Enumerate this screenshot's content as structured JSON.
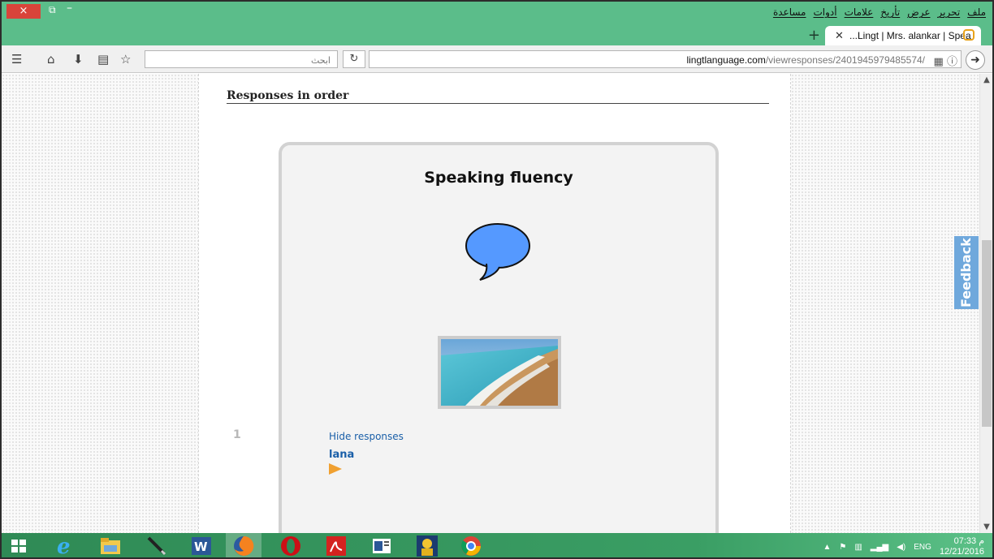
{
  "window": {
    "close_glyph": "×",
    "restore_glyph": "⧉",
    "minimize_glyph": "–"
  },
  "menu": {
    "items": [
      "ملف",
      "تحرير",
      "عرض",
      "تأريخ",
      "علامات",
      "أدوات",
      "مساعدة"
    ]
  },
  "tab": {
    "title": "...Lingt | Mrs. alankar | Spea",
    "close_glyph": "✕",
    "new_tab_glyph": "+"
  },
  "navbar": {
    "search_placeholder": "ابحث",
    "url_domain": "lingtlanguage.com",
    "url_path": "/viewresponses/2401945979485574/"
  },
  "page": {
    "heading": "Responses in order",
    "card_title": "Speaking fluency",
    "hide_responses": "Hide responses",
    "responder": "lana",
    "row_number": "1",
    "feedback_tab": "Feedback"
  },
  "taskbar": {
    "lang": "ENG",
    "time": "07:33 م",
    "date": "12/21/2016"
  },
  "colors": {
    "chrome_green": "#5bbd8a",
    "bubble_blue": "#5599ff",
    "link_blue": "#1a5fa8",
    "play_orange": "#f0a030"
  }
}
